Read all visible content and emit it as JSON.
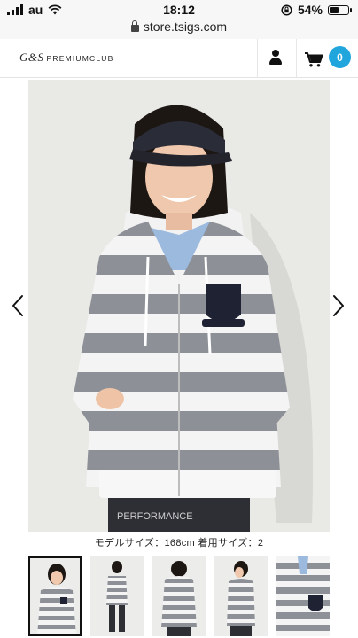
{
  "status_bar": {
    "carrier": "au",
    "time": "18:12",
    "battery_percent": "54%",
    "battery_level": 0.54,
    "url": "store.tsigs.com"
  },
  "header": {
    "logo_brand": "G&S",
    "logo_sub": "PREMIUMCLUB",
    "cart_count": "0",
    "accent_color": "#20a5dd"
  },
  "product": {
    "prev_icon": "chevron-left-icon",
    "next_icon": "chevron-right-icon",
    "caption": "モデルサイズ：168cm 着用サイズ：2"
  },
  "thumbnails": {
    "count": 5,
    "active_index": 0
  }
}
